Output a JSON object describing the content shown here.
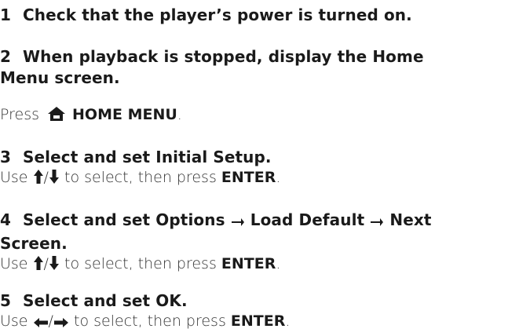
{
  "steps": [
    {
      "number": "1",
      "title": "Check that the player’s power is turned on."
    },
    {
      "number": "2",
      "title_line1": "When playback is stopped, display the Home",
      "title_line2": "Menu screen.",
      "body_prefix": "Press",
      "body_button": "HOME MENU",
      "body_suffix": "."
    },
    {
      "number": "3",
      "title": "Select and set Initial Setup.",
      "body_prefix": "Use",
      "body_middle": "to select, then press",
      "body_button": "ENTER",
      "body_suffix": ".",
      "arrow_separator": "/"
    },
    {
      "number": "4",
      "title_part1": "Select and set Options",
      "title_part2": "Load Default",
      "title_part3": "Next",
      "title_line2": "Screen.",
      "body_prefix": "Use",
      "body_middle": "to select, then press",
      "body_button": "ENTER",
      "body_suffix": ".",
      "arrow_separator": "/"
    },
    {
      "number": "5",
      "title": "Select and set OK.",
      "body_prefix": "Use",
      "body_middle": "to select, then press",
      "body_button": "ENTER",
      "body_suffix": ".",
      "arrow_separator": "/"
    }
  ],
  "icons": {
    "home": "home-icon",
    "up": "up-arrow-icon",
    "down": "down-arrow-icon",
    "left": "left-arrow-icon",
    "right": "right-arrow-icon",
    "menu_arrow": "right-arrow-icon"
  },
  "colors": {
    "text": "#1a1a1a",
    "body_text": "#333333"
  }
}
